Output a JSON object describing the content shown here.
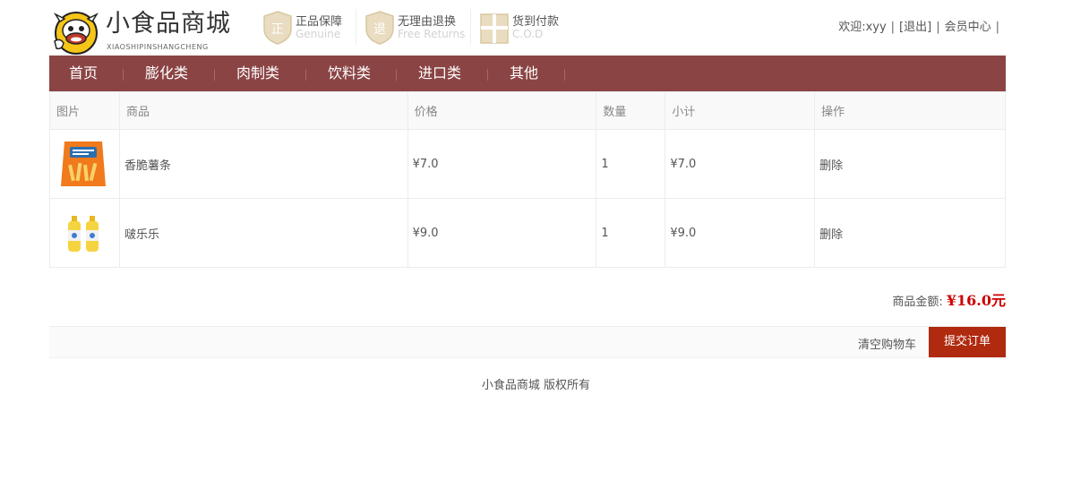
{
  "header": {
    "title": "小食品商城",
    "subtitle": "XIAOSHIPINSHANGCHENG",
    "promos": [
      {
        "icon": "genuine-badge-icon",
        "title": "正品保障",
        "sub": "Genuine"
      },
      {
        "icon": "return-badge-icon",
        "title": "无理由退换",
        "sub": "Free Returns"
      },
      {
        "icon": "gift-box-icon",
        "title": "货到付款",
        "sub": "C.O.D"
      }
    ],
    "user": {
      "greeting": "欢迎:xyy",
      "logout": "[退出]",
      "member_center": "会员中心",
      "sep": "|"
    }
  },
  "nav": {
    "items": [
      "首页",
      "膨化类",
      "肉制类",
      "饮料类",
      "进口类",
      "其他"
    ],
    "sep": "|"
  },
  "cart": {
    "headers": [
      "图片",
      "商品",
      "价格",
      "数量",
      "小计",
      "操作"
    ],
    "rows": [
      {
        "name": "香脆薯条",
        "price": "¥7.0",
        "qty": "1",
        "subtotal": "¥7.0",
        "action": "删除"
      },
      {
        "name": "啵乐乐",
        "price": "¥9.0",
        "qty": "1",
        "subtotal": "¥9.0",
        "action": "删除"
      }
    ]
  },
  "summary": {
    "label": "商品金额:",
    "amount": "¥16.0元"
  },
  "actions": {
    "clear": "清空购物车",
    "submit": "提交订单"
  },
  "footer": {
    "text": "小食品商城 版权所有"
  },
  "colors": {
    "nav_bg": "#8b4444",
    "accent_red": "#c00000",
    "submit_bg": "#b02a10"
  }
}
